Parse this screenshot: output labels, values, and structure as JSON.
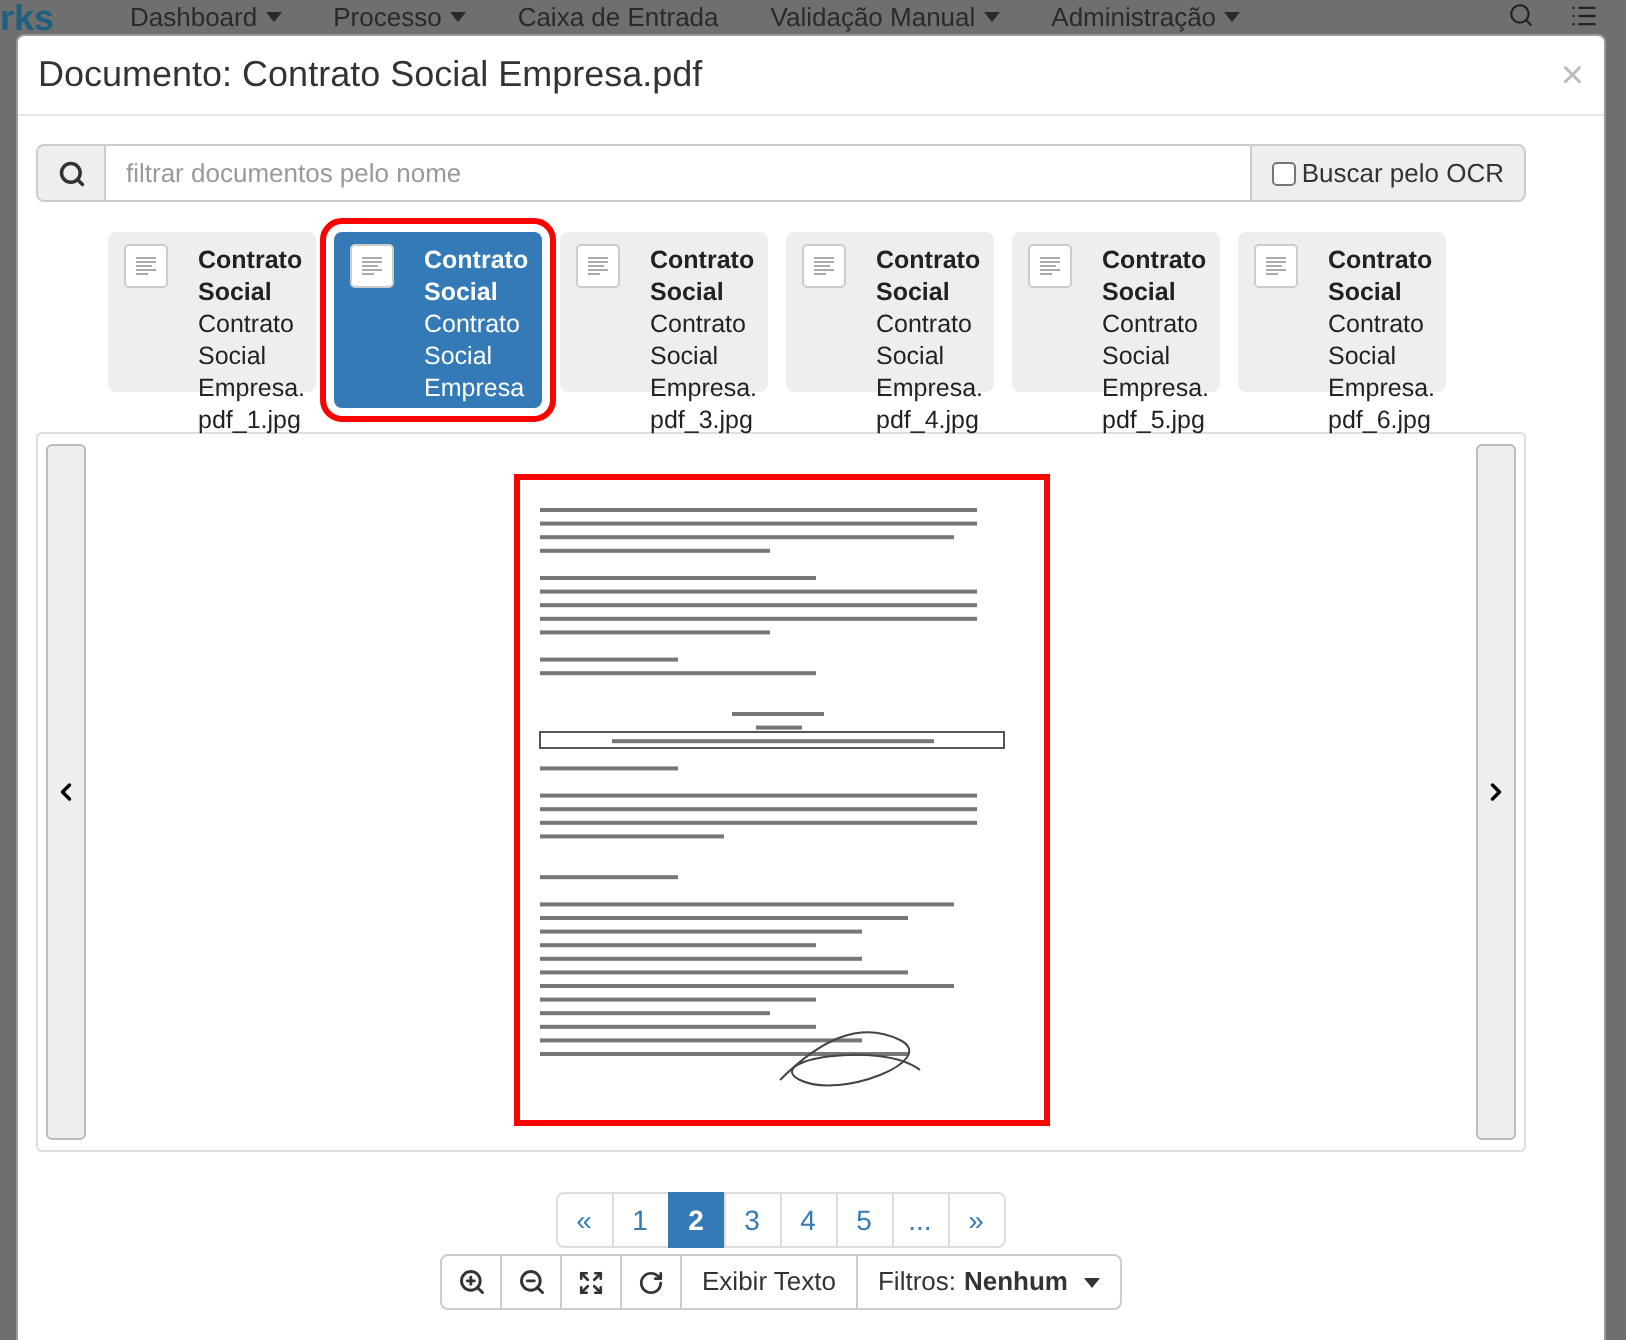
{
  "navbar": {
    "brand": "rks",
    "items": [
      {
        "label": "Dashboard",
        "dropdown": true
      },
      {
        "label": "Processo",
        "dropdown": true
      },
      {
        "label": "Caixa de Entrada",
        "dropdown": false
      },
      {
        "label": "Validação Manual",
        "dropdown": true
      },
      {
        "label": "Administração",
        "dropdown": true
      }
    ]
  },
  "modal": {
    "title": "Documento: Contrato Social Empresa.pdf",
    "close": "×"
  },
  "search": {
    "placeholder": "filtrar documentos pelo nome",
    "ocr_label": "Buscar pelo OCR",
    "ocr_checked": false
  },
  "thumbnails": [
    {
      "title": "Contrato Social",
      "name": "Contrato Social Empresa. pdf_1.jpg",
      "selected": false
    },
    {
      "title": "Contrato Social",
      "name": "Contrato Social Empresa",
      "selected": true
    },
    {
      "title": "Contrato Social",
      "name": "Contrato Social Empresa. pdf_3.jpg",
      "selected": false
    },
    {
      "title": "Contrato Social",
      "name": "Contrato Social Empresa. pdf_4.jpg",
      "selected": false
    },
    {
      "title": "Contrato Social",
      "name": "Contrato Social Empresa. pdf_5.jpg",
      "selected": false
    },
    {
      "title": "Contrato Social",
      "name": "Contrato Social Empresa. pdf_6.jpg",
      "selected": false
    }
  ],
  "pagination": [
    {
      "label": "«",
      "selected": false
    },
    {
      "label": "1",
      "selected": false
    },
    {
      "label": "2",
      "selected": true
    },
    {
      "label": "3",
      "selected": false
    },
    {
      "label": "4",
      "selected": false
    },
    {
      "label": "5",
      "selected": false
    },
    {
      "label": "...",
      "selected": false
    },
    {
      "label": "»",
      "selected": false
    }
  ],
  "toolbar": {
    "show_text": "Exibir Texto",
    "filters_label": "Filtros:",
    "filters_value": "Nenhum"
  }
}
